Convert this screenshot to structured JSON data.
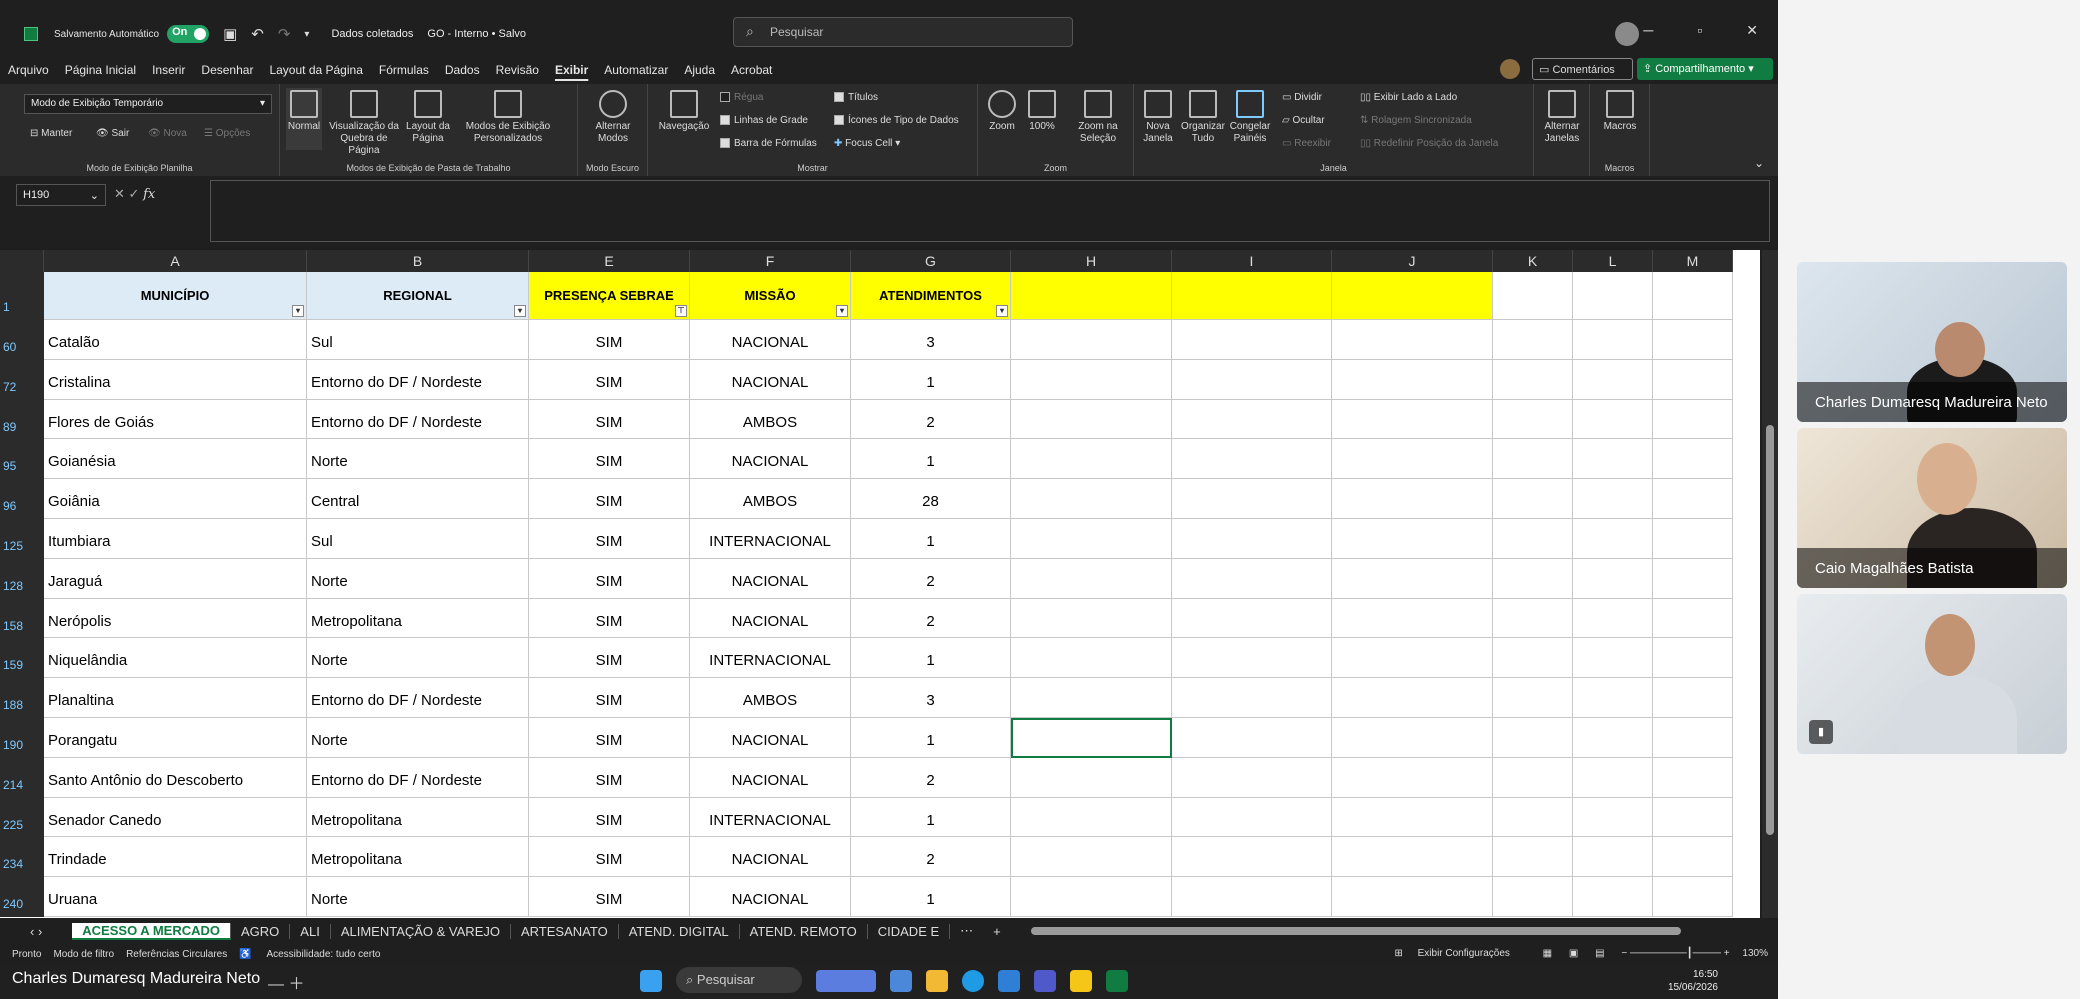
{
  "app": {
    "autosave_label": "Salvamento Automático",
    "autosave_state": "On",
    "doc_title": "Dados coletados",
    "sensitivity": "GO - Interno • Salvo",
    "search_placeholder": "Pesquisar"
  },
  "menu": [
    "Arquivo",
    "Página Inicial",
    "Inserir",
    "Desenhar",
    "Layout da Página",
    "Fórmulas",
    "Dados",
    "Revisão",
    "Exibir",
    "Automatizar",
    "Ajuda",
    "Acrobat"
  ],
  "menu_active": "Exibir",
  "comments_label": "Comentários",
  "share_label": "Compartilhamento",
  "ribbon": {
    "view_mode_dropdown": "Modo de Exibição Temporário",
    "keep": "Manter",
    "exit": "Sair",
    "new": "Nova",
    "options": "Opções",
    "group1": "Modo de Exibição Planilha",
    "normal": "Normal",
    "page_break": "Visualização da Quebra de Página",
    "page_layout": "Layout da Página",
    "custom_views": "Modos de Exibição Personalizados",
    "group2": "Modos de Exibição de Pasta de Trabalho",
    "dark_mode": "Alternar Modos",
    "group3": "Modo Escuro",
    "navigation": "Navegação",
    "ruler": "Régua",
    "gridlines": "Linhas de Grade",
    "formula_bar": "Barra de Fórmulas",
    "titles": "Títulos",
    "data_type_icons": "Ícones de Tipo de Dados",
    "focus_cell": "Focus Cell",
    "group4": "Mostrar",
    "zoom": "Zoom",
    "zoom100": "100%",
    "zoom_sel": "Zoom na Seleção",
    "group5": "Zoom",
    "new_window": "Nova Janela",
    "arrange_all": "Organizar Tudo",
    "freeze": "Congelar Painéis",
    "split": "Dividir",
    "hide": "Ocultar",
    "unhide": "Reexibir",
    "side_by_side": "Exibir Lado a Lado",
    "sync_scroll": "Rolagem Sincronizada",
    "reset_pos": "Redefinir Posição da Janela",
    "switch_windows": "Alternar Janelas",
    "group6": "Janela",
    "macros": "Macros",
    "group7": "Macros"
  },
  "formula": {
    "namebox": "H190",
    "content": ""
  },
  "columns": [
    "A",
    "B",
    "E",
    "F",
    "G",
    "H",
    "I",
    "J",
    "K",
    "L",
    "M"
  ],
  "headers": {
    "a": "MUNICÍPIO",
    "b": "REGIONAL",
    "e": "PRESENÇA SEBRAE",
    "f": "MISSÃO",
    "g": "ATENDIMENTOS"
  },
  "header_row_num": "1",
  "rows": [
    {
      "n": "60",
      "a": "Catalão",
      "b": "Sul",
      "e": "SIM",
      "f": "NACIONAL",
      "g": "3"
    },
    {
      "n": "72",
      "a": "Cristalina",
      "b": "Entorno do DF / Nordeste",
      "e": "SIM",
      "f": "NACIONAL",
      "g": "1"
    },
    {
      "n": "89",
      "a": "Flores de Goiás",
      "b": "Entorno do DF / Nordeste",
      "e": "SIM",
      "f": "AMBOS",
      "g": "2"
    },
    {
      "n": "95",
      "a": "Goianésia",
      "b": "Norte",
      "e": "SIM",
      "f": "NACIONAL",
      "g": "1"
    },
    {
      "n": "96",
      "a": "Goiânia",
      "b": "Central",
      "e": "SIM",
      "f": "AMBOS",
      "g": "28"
    },
    {
      "n": "125",
      "a": "Itumbiara",
      "b": "Sul",
      "e": "SIM",
      "f": "INTERNACIONAL",
      "g": "1"
    },
    {
      "n": "128",
      "a": "Jaraguá",
      "b": "Norte",
      "e": "SIM",
      "f": "NACIONAL",
      "g": "2"
    },
    {
      "n": "158",
      "a": "Nerópolis",
      "b": "Metropolitana",
      "e": "SIM",
      "f": "NACIONAL",
      "g": "2"
    },
    {
      "n": "159",
      "a": "Niquelândia",
      "b": "Norte",
      "e": "SIM",
      "f": "INTERNACIONAL",
      "g": "1"
    },
    {
      "n": "188",
      "a": "Planaltina",
      "b": "Entorno do DF / Nordeste",
      "e": "SIM",
      "f": "AMBOS",
      "g": "3"
    },
    {
      "n": "190",
      "a": "Porangatu",
      "b": "Norte",
      "e": "SIM",
      "f": "NACIONAL",
      "g": "1"
    },
    {
      "n": "214",
      "a": "Santo Antônio do Descoberto",
      "b": "Entorno do DF / Nordeste",
      "e": "SIM",
      "f": "NACIONAL",
      "g": "2"
    },
    {
      "n": "225",
      "a": "Senador Canedo",
      "b": "Metropolitana",
      "e": "SIM",
      "f": "INTERNACIONAL",
      "g": "1"
    },
    {
      "n": "234",
      "a": "Trindade",
      "b": "Metropolitana",
      "e": "SIM",
      "f": "NACIONAL",
      "g": "2"
    },
    {
      "n": "240",
      "a": "Uruana",
      "b": "Norte",
      "e": "SIM",
      "f": "NACIONAL",
      "g": "1"
    }
  ],
  "sheet_tabs": [
    "ACESSO A MERCADO",
    "AGRO",
    "ALI",
    "ALIMENTAÇÃO & VAREJO",
    "ARTESANATO",
    "ATEND. DIGITAL",
    "ATEND. REMOTO",
    "CIDADE E"
  ],
  "active_sheet": "ACESSO A MERCADO",
  "status": {
    "ready": "Pronto",
    "filter_mode": "Modo de filtro",
    "circular": "Referências Circulares",
    "accessibility": "Acessibilidade: tudo certo",
    "display_settings": "Exibir Configurações",
    "zoom": "130%"
  },
  "taskbar": {
    "presenter": "Charles Dumaresq Madureira Neto",
    "search": "Pesquisar",
    "time": "16:50",
    "date": "15/06/2026"
  },
  "participants": [
    {
      "name": "Charles Dumaresq Madureira Neto"
    },
    {
      "name": "Caio Magalhães Batista"
    },
    {
      "name": ""
    }
  ]
}
